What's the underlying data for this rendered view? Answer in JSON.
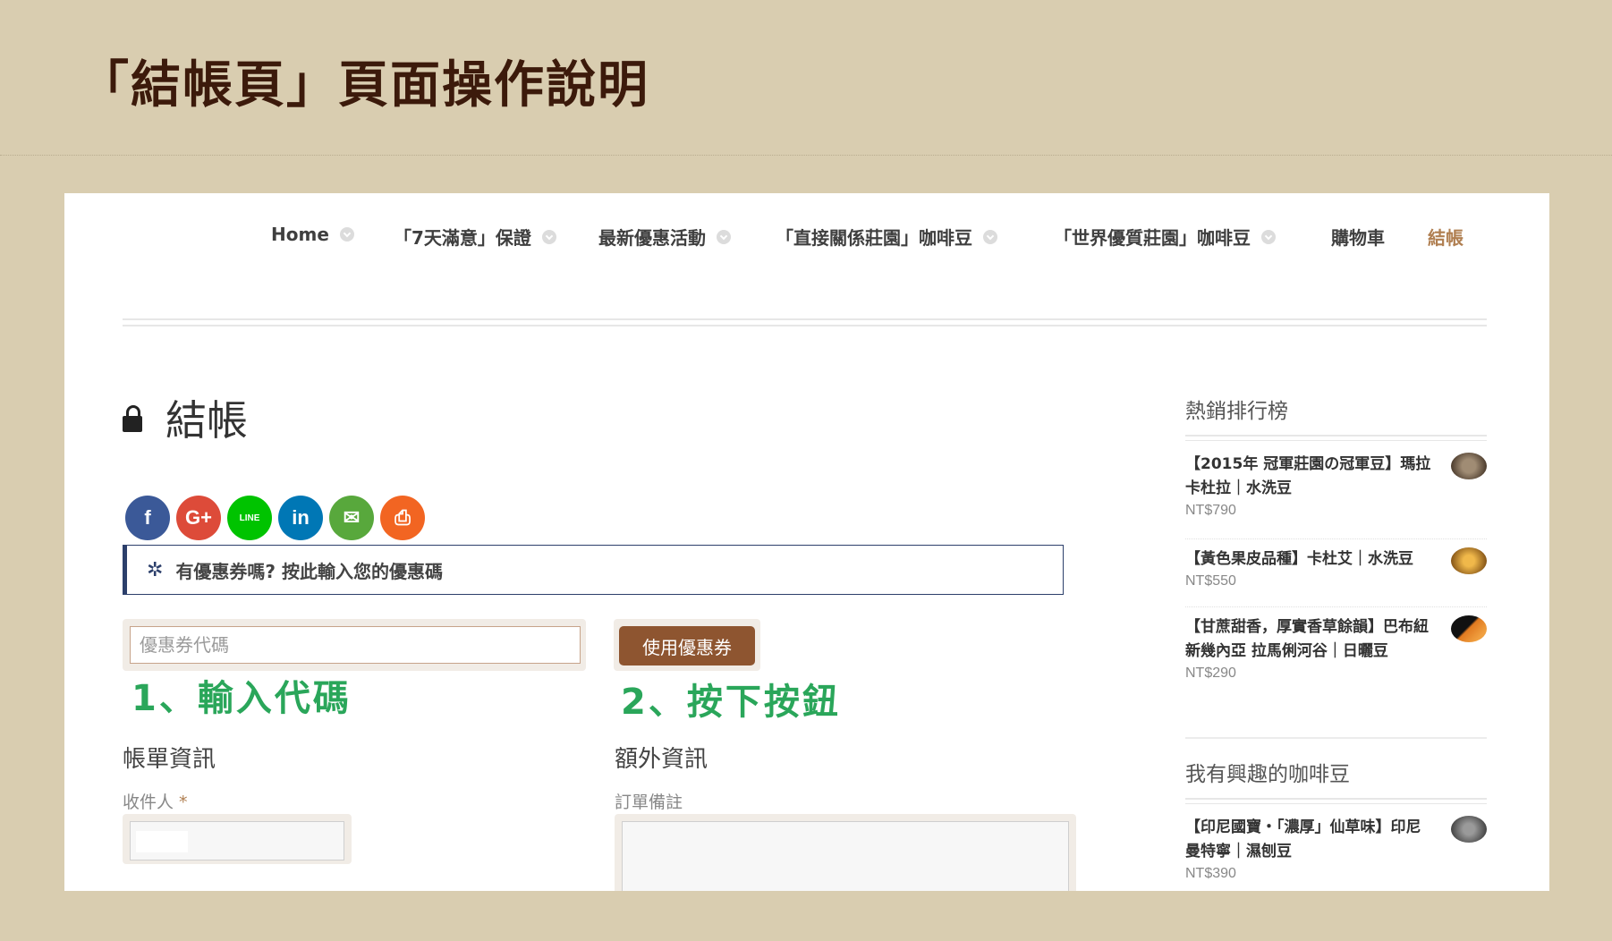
{
  "page_title": "「結帳頁」頁面操作說明",
  "nav": {
    "items": [
      {
        "label": "Home"
      },
      {
        "label": "「7天滿意」保證"
      },
      {
        "label": "最新優惠活動"
      },
      {
        "label": "「直接關係莊園」咖啡豆"
      },
      {
        "label": "「世界優質莊園」咖啡豆"
      },
      {
        "label": "購物車"
      },
      {
        "label": "結帳"
      }
    ]
  },
  "checkout": {
    "title": "結帳",
    "share_icons": [
      "facebook-icon",
      "google-plus-icon",
      "line-icon",
      "linkedin-icon",
      "email-icon",
      "print-icon"
    ],
    "share_labels": {
      "facebook": "f",
      "google": "G+",
      "line": "LINE",
      "linkedin": "in",
      "email": "✉",
      "print": "⎙"
    },
    "coupon_notice": "有優惠券嗎? 按此輸入您的優惠碼",
    "coupon_placeholder": "優惠券代碼",
    "apply_button": "使用優惠券",
    "step1": "1、輸入代碼",
    "step2": "2、按下按鈕",
    "billing_heading": "帳單資訊",
    "additional_heading": "額外資訊",
    "recipient_label": "收件人",
    "required_mark": "*",
    "order_notes_label": "訂單備註"
  },
  "sidebar": {
    "bestsellers_title": "熱銷排行榜",
    "bestsellers": [
      {
        "name": "【2015年 冠軍莊園の冠軍豆】瑪拉卡杜拉｜水洗豆",
        "price": "NT$790"
      },
      {
        "name": "【黃色果皮品種】卡杜艾｜水洗豆",
        "price": "NT$550"
      },
      {
        "name": "【甘蔗甜香，厚實香草餘韻】巴布紐新幾內亞 拉馬俐河谷｜日曬豆",
        "price": "NT$290"
      }
    ],
    "interest_title": "我有興趣的咖啡豆",
    "interest": [
      {
        "name": "【印尼國寶・「濃厚」仙草味】印尼 曼特寧｜濕刨豆",
        "price": "NT$390"
      }
    ]
  },
  "colors": {
    "background": "#d9cdb0",
    "title": "#3c1a0b",
    "accent": "#b07f51",
    "button": "#8e5530",
    "step_green": "#2aa65a",
    "notice_border": "#2c3f6b"
  }
}
